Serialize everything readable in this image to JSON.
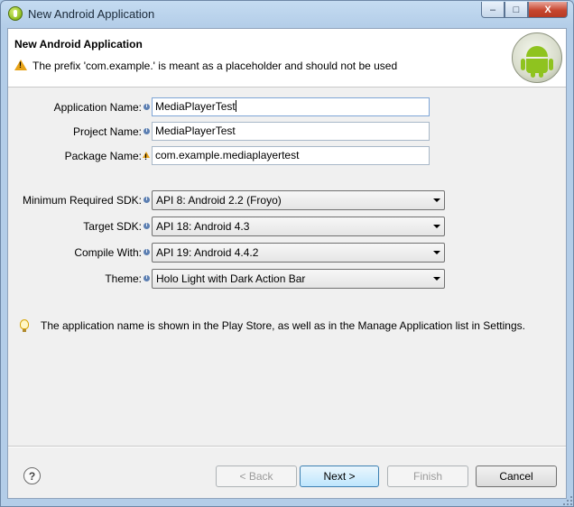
{
  "window": {
    "title": "New Android Application",
    "caption_buttons": {
      "minimize": "–",
      "maximize": "□",
      "close": "X"
    }
  },
  "banner": {
    "title": "New Android Application",
    "message": "The prefix 'com.example.' is meant as a placeholder and should not be used",
    "message_icon": "warning-icon",
    "logo": "android-logo"
  },
  "fields": {
    "application_name": {
      "label": "Application Name:",
      "value": "MediaPlayerTest",
      "icon": "info-icon"
    },
    "project_name": {
      "label": "Project Name:",
      "value": "MediaPlayerTest",
      "icon": "info-icon"
    },
    "package_name": {
      "label": "Package Name:",
      "value": "com.example.mediaplayertest",
      "icon": "warning-icon"
    }
  },
  "selects": {
    "min_sdk": {
      "label": "Minimum Required SDK:",
      "value": "API 8: Android 2.2 (Froyo)"
    },
    "target_sdk": {
      "label": "Target SDK:",
      "value": "API 18: Android 4.3"
    },
    "compile_with": {
      "label": "Compile With:",
      "value": "API 19: Android 4.4.2"
    },
    "theme": {
      "label": "Theme:",
      "value": "Holo Light with Dark Action Bar"
    }
  },
  "hint": {
    "icon": "lightbulb-icon",
    "text": "The application name is shown in the Play Store, as well as in the Manage Application list in Settings."
  },
  "footer": {
    "help": "?",
    "back": "< Back",
    "next": "Next >",
    "finish": "Finish",
    "cancel": "Cancel"
  },
  "colors": {
    "warning": "#e8a317",
    "info": "#5c7fb2",
    "android_green": "#8fc31f",
    "default_button": "#3c7fb1"
  }
}
